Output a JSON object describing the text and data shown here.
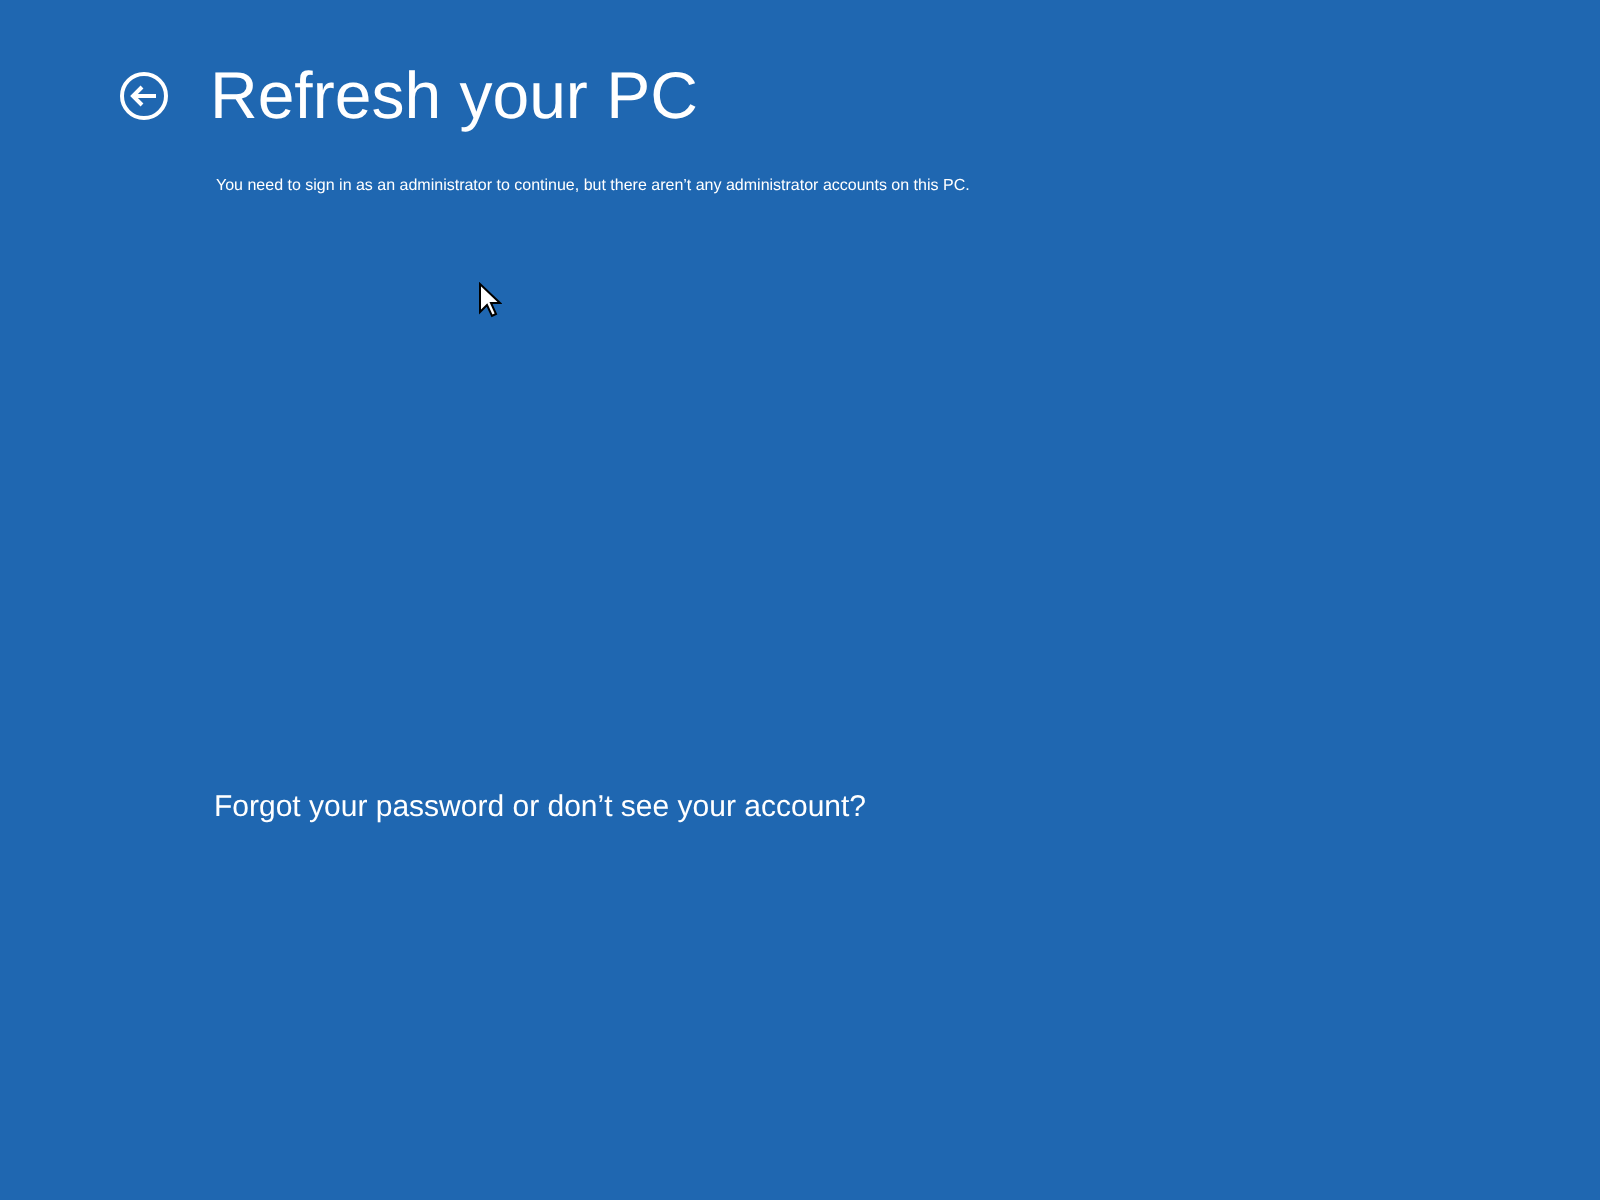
{
  "header": {
    "title": "Refresh your PC"
  },
  "message": "You need to sign in as an administrator to continue, but there aren’t any administrator accounts on this PC.",
  "link": "Forgot your password or don’t see your account?"
}
